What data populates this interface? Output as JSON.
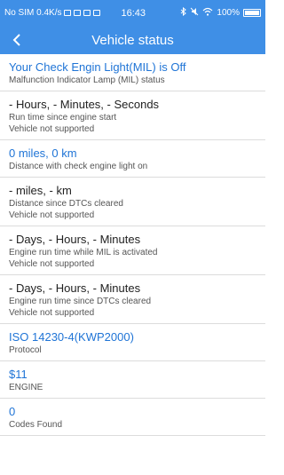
{
  "status_bar": {
    "carrier": "No SIM 0.4K/s",
    "time": "16:43",
    "battery": "100%"
  },
  "app_bar": {
    "title": "Vehicle status",
    "back_icon": "chevron-left-icon"
  },
  "items": [
    {
      "value": "Your Check Engin Light(MIL) is Off",
      "lines": [
        "Malfunction Indicator Lamp (MIL) status"
      ],
      "accent": true
    },
    {
      "value": "- Hours, - Minutes, - Seconds",
      "lines": [
        "Run time since engine start",
        "Vehicle not supported"
      ],
      "accent": false
    },
    {
      "value": "0 miles, 0 km",
      "lines": [
        "Distance with check engine light on"
      ],
      "accent": true
    },
    {
      "value": "- miles, - km",
      "lines": [
        "Distance since DTCs cleared",
        "Vehicle not supported"
      ],
      "accent": false
    },
    {
      "value": "- Days, - Hours, - Minutes",
      "lines": [
        "Engine run time while MIL is activated",
        "Vehicle not supported"
      ],
      "accent": false
    },
    {
      "value": "- Days, - Hours, - Minutes",
      "lines": [
        "Engine run time since DTCs cleared",
        "Vehicle not supported"
      ],
      "accent": false
    },
    {
      "value": "ISO 14230-4(KWP2000)",
      "lines": [
        "Protocol"
      ],
      "accent": true
    },
    {
      "value": "$11",
      "lines": [
        "ENGINE"
      ],
      "accent": true
    },
    {
      "value": "0",
      "lines": [
        "Codes Found"
      ],
      "accent": true
    }
  ],
  "colors": {
    "header": "#3f8fe6",
    "accent_text": "#1f74d6"
  }
}
